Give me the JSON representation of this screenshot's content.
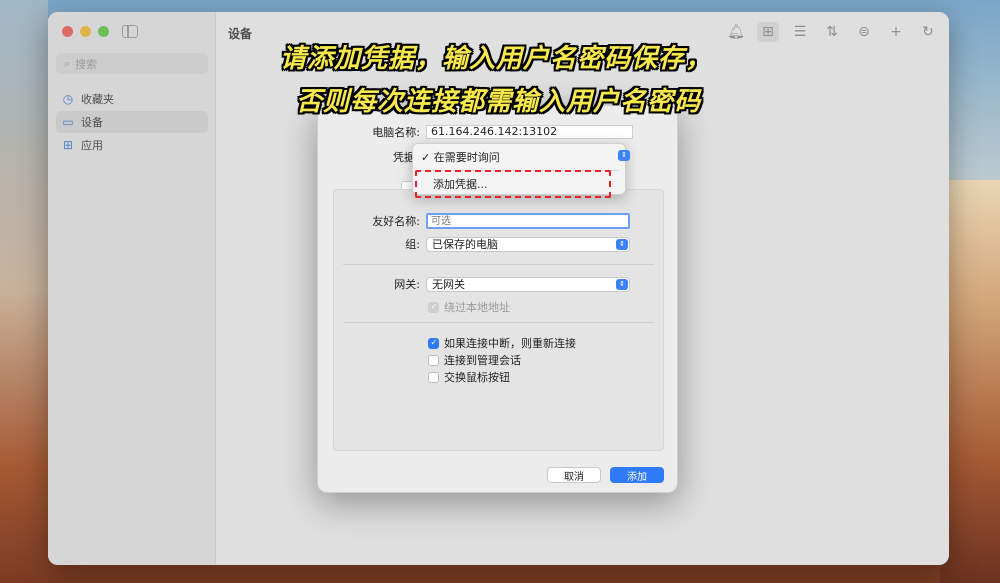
{
  "window": {
    "title": "设备",
    "search_placeholder": "搜索"
  },
  "sidebar": {
    "items": [
      {
        "label": "收藏夹",
        "icon": "clock-icon"
      },
      {
        "label": "设备",
        "icon": "monitor-icon",
        "active": true
      },
      {
        "label": "应用",
        "icon": "grid-icon"
      }
    ]
  },
  "captions": {
    "line1": "请添加凭据，输入用户名密码保存，",
    "line2": "否则每次连接都需输入用户名密码"
  },
  "dialog": {
    "pc_name_label": "电脑名称:",
    "pc_name_value": "61.164.246.142:13102",
    "credentials_label": "凭据",
    "credentials_menu": {
      "selected": "✓ 在需要时询问",
      "add_item": "添加凭据..."
    },
    "friendly_name_label": "友好名称:",
    "friendly_name_placeholder": "可选",
    "group_label": "组:",
    "group_value": "已保存的电脑",
    "gateway_label": "网关:",
    "gateway_value": "无网关",
    "bypass_local": "绕过本地地址",
    "reconnect": "如果连接中断，则重新连接",
    "admin_session": "连接到管理会话",
    "swap_mouse": "交换鼠标按钮",
    "cancel": "取消",
    "add": "添加"
  },
  "colors": {
    "accent": "#2f7bf5",
    "caption": "#f6e84d",
    "highlight_dash": "#e2252b"
  }
}
